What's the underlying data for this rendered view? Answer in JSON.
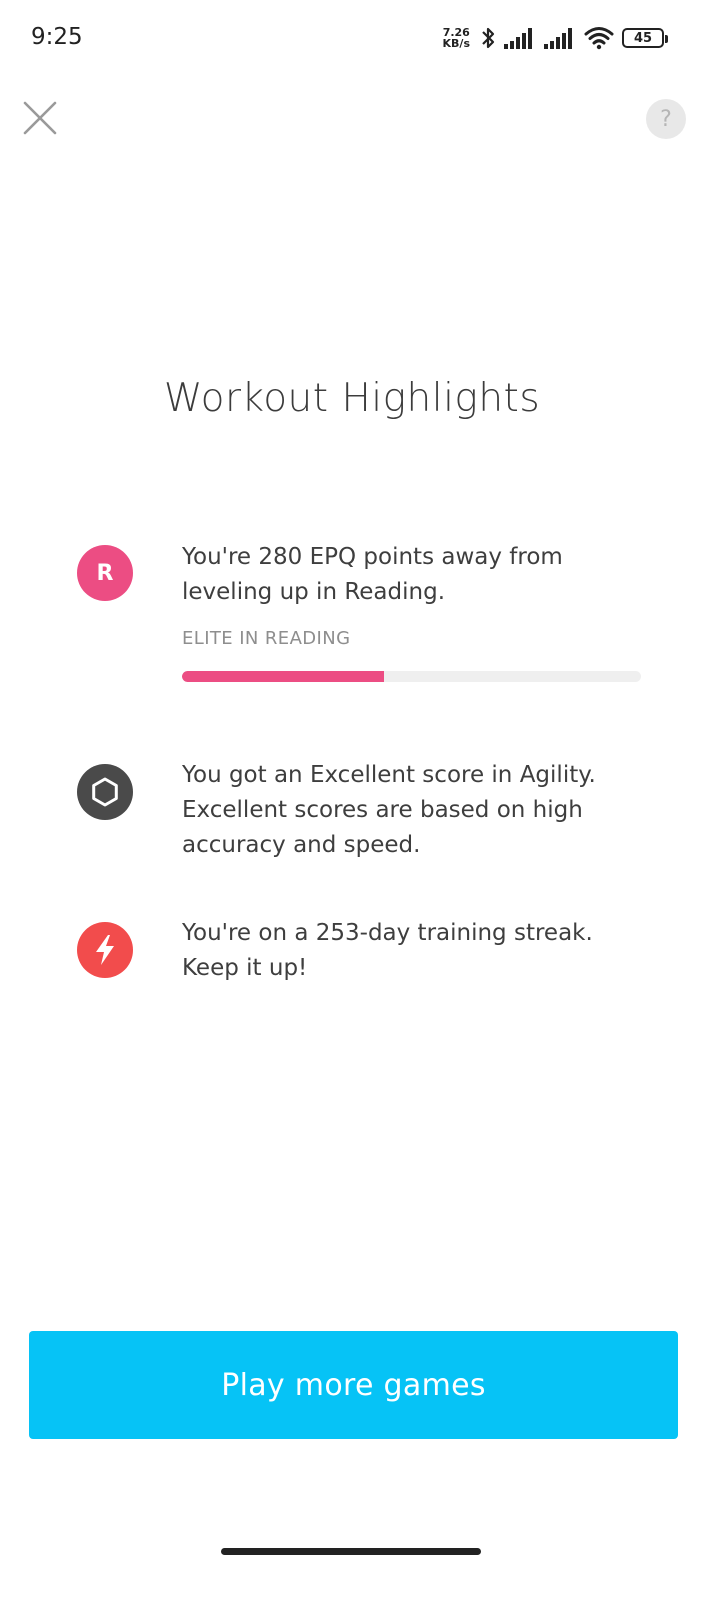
{
  "status_bar": {
    "time": "9:25",
    "net_speed_value": "7.26",
    "net_speed_unit": "KB/s",
    "battery": "45",
    "icons": [
      "bluetooth-icon",
      "signal-icon",
      "signal-icon",
      "wifi-icon",
      "battery-icon"
    ]
  },
  "header": {
    "close_icon": "close-icon",
    "help_label": "?"
  },
  "title": "Workout Highlights",
  "highlights": [
    {
      "icon_label": "R",
      "icon_color": "#ec4d83",
      "text": "You're 280 EPQ points away from leveling up in Reading.",
      "sub_label": "ELITE IN READING",
      "progress_fraction": 0.44,
      "progress_color": "#ec4d83"
    },
    {
      "icon": "hexagon-icon",
      "icon_color": "#4a4a4a",
      "text": "You got an Excellent score in Agility. Excellent scores are based on high accuracy and speed."
    },
    {
      "icon": "lightning-icon",
      "icon_color": "#f24c4c",
      "text": "You're on a 253-day training streak. Keep it up!"
    }
  ],
  "primary_button": {
    "label": "Play more games",
    "color": "#06c3f6"
  }
}
